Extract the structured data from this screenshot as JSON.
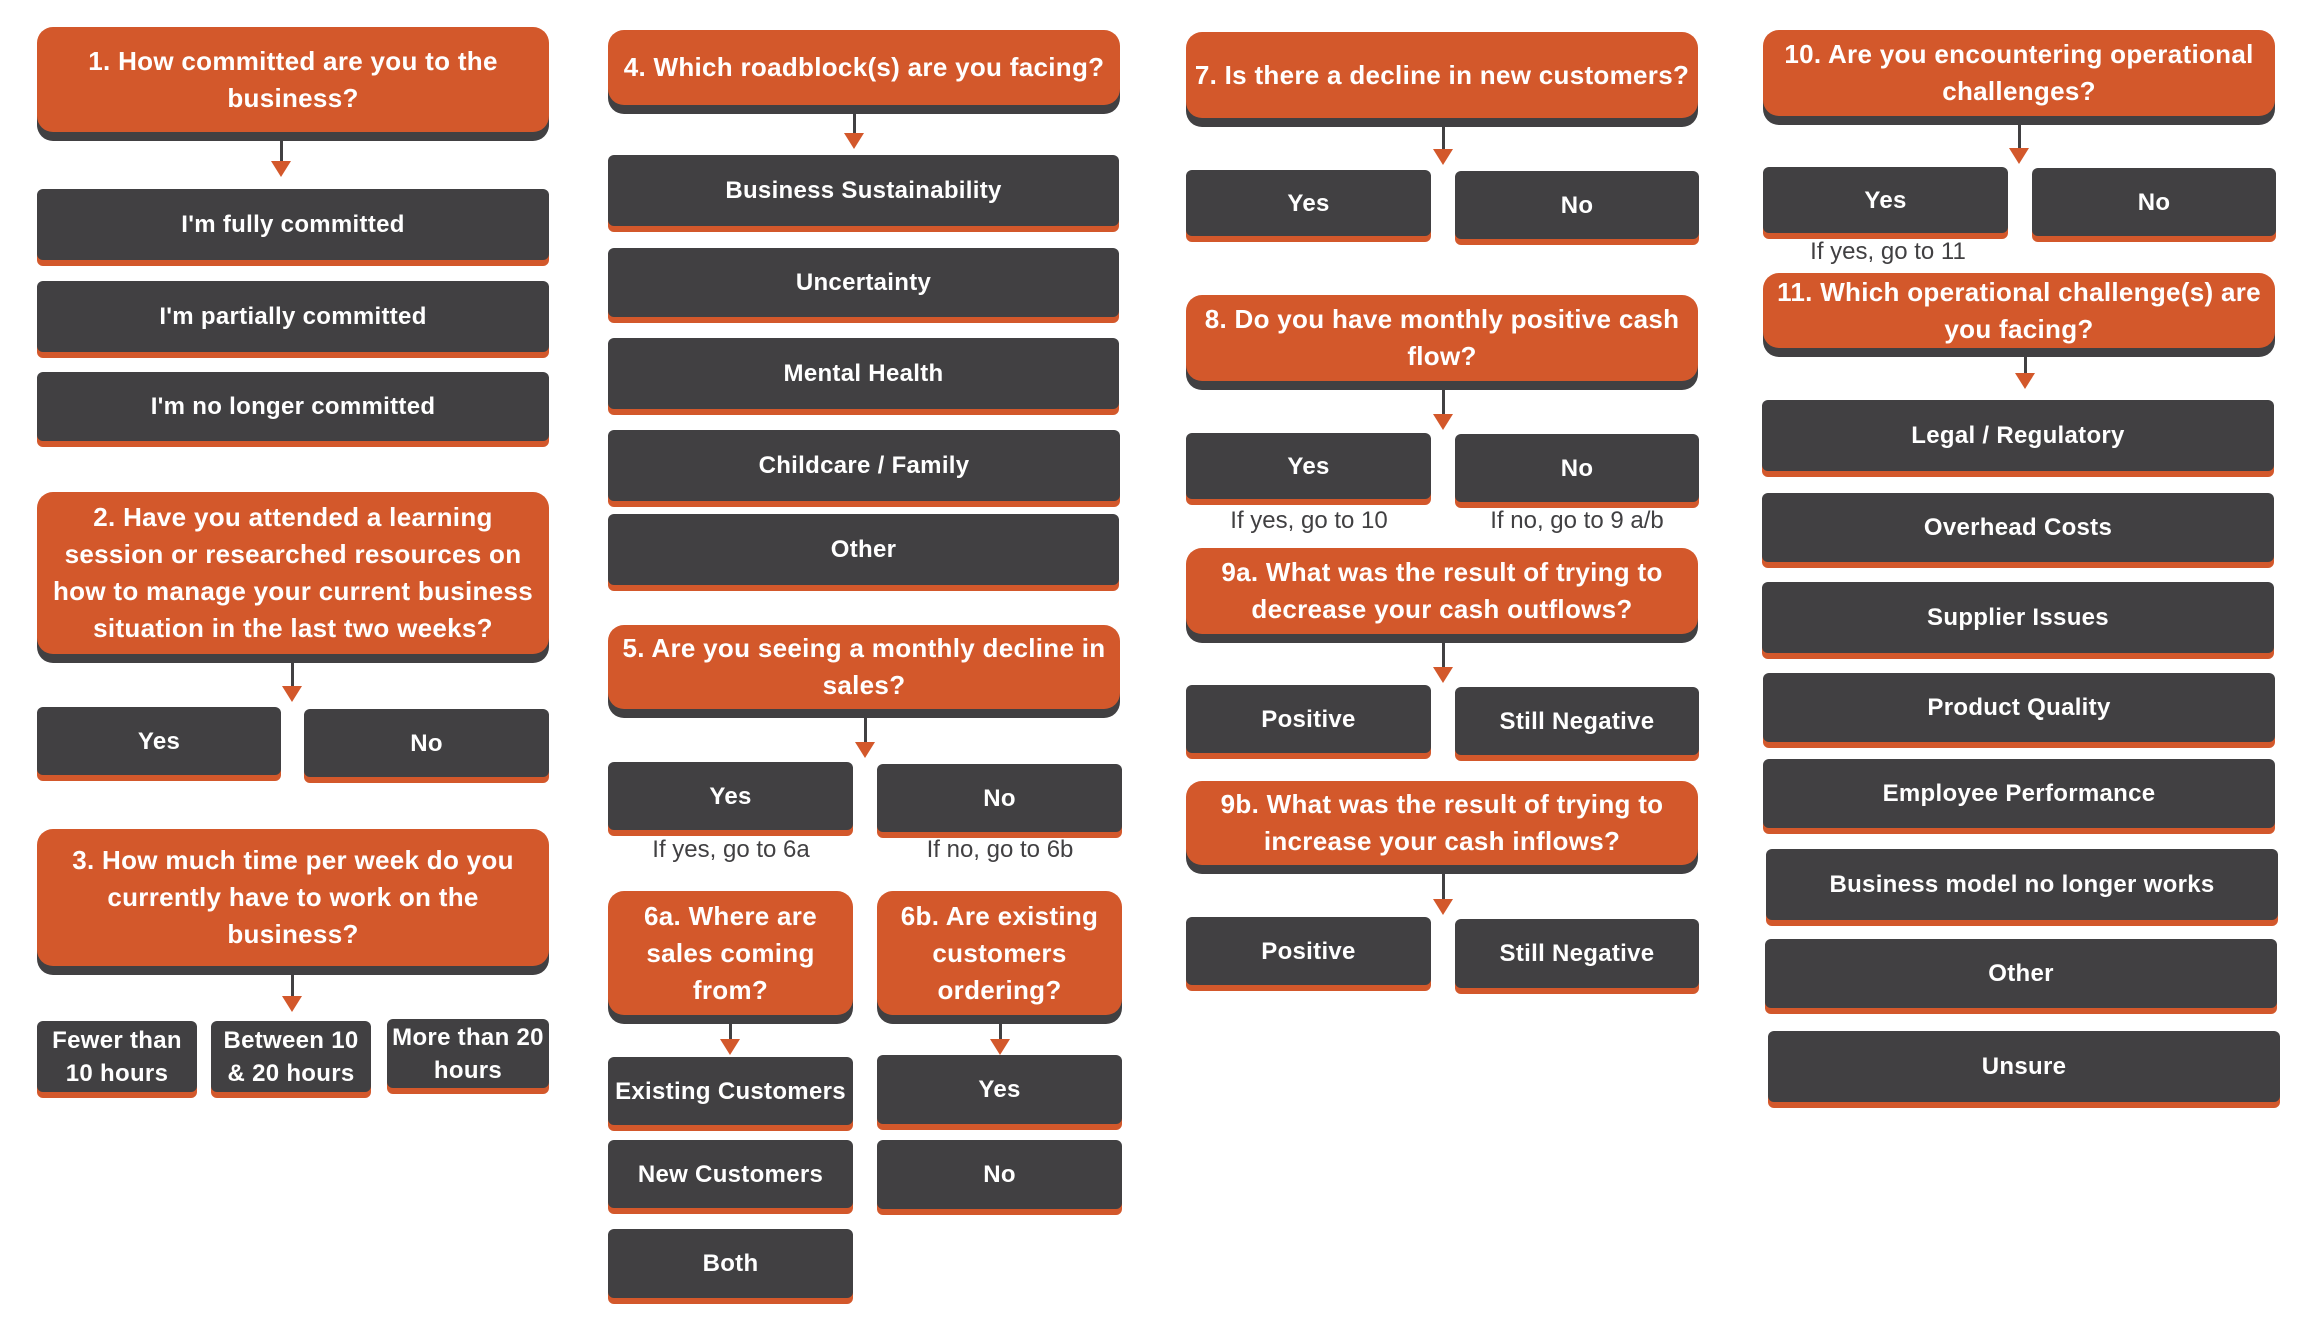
{
  "colors": {
    "question": "#d3582b",
    "answer": "#414042",
    "caption": "#414042"
  },
  "q1": {
    "text": "1. How committed are you to the business?",
    "options": [
      "I'm fully committed",
      "I'm partially committed",
      "I'm no longer committed"
    ]
  },
  "q2": {
    "text": "2. Have you attended a learning session or researched resources on how to manage your current business situation in the last two weeks?",
    "options": [
      "Yes",
      "No"
    ]
  },
  "q3": {
    "text": "3. How much time per week do you currently have to work on the business?",
    "options": [
      "Fewer than 10 hours",
      "Between 10 & 20 hours",
      "More than 20 hours"
    ]
  },
  "q4": {
    "text": "4. Which roadblock(s) are you facing?",
    "options": [
      "Business Sustainability",
      "Uncertainty",
      "Mental Health",
      "Childcare / Family",
      "Other"
    ]
  },
  "q5": {
    "text": "5. Are you seeing a monthly decline in sales?",
    "options": [
      "Yes",
      "No"
    ],
    "captions": [
      "If yes, go to 6a",
      "If no, go to 6b"
    ]
  },
  "q6a": {
    "text": "6a. Where are sales coming from?",
    "options": [
      "Existing Customers",
      "New Customers",
      "Both"
    ]
  },
  "q6b": {
    "text": "6b. Are existing customers ordering?",
    "options": [
      "Yes",
      "No"
    ]
  },
  "q7": {
    "text": "7. Is there a decline in new customers?",
    "options": [
      "Yes",
      "No"
    ]
  },
  "q8": {
    "text": "8. Do you have monthly positive cash flow?",
    "options": [
      "Yes",
      "No"
    ],
    "captions": [
      "If yes, go to 10",
      "If no, go to 9 a/b"
    ]
  },
  "q9a": {
    "text": "9a. What was the result of trying to decrease your cash outflows?",
    "options": [
      "Positive",
      "Still Negative"
    ]
  },
  "q9b": {
    "text": "9b. What was the result of trying to increase your cash inflows?",
    "options": [
      "Positive",
      "Still Negative"
    ]
  },
  "q10": {
    "text": "10. Are you encountering operational challenges?",
    "options": [
      "Yes",
      "No"
    ],
    "captions": [
      "If yes, go to 11"
    ]
  },
  "q11": {
    "text": "11. Which operational challenge(s) are you facing?",
    "options": [
      "Legal / Regulatory",
      "Overhead Costs",
      "Supplier Issues",
      "Product Quality",
      "Employee Performance",
      "Business model no longer works",
      "Other",
      "Unsure"
    ]
  }
}
